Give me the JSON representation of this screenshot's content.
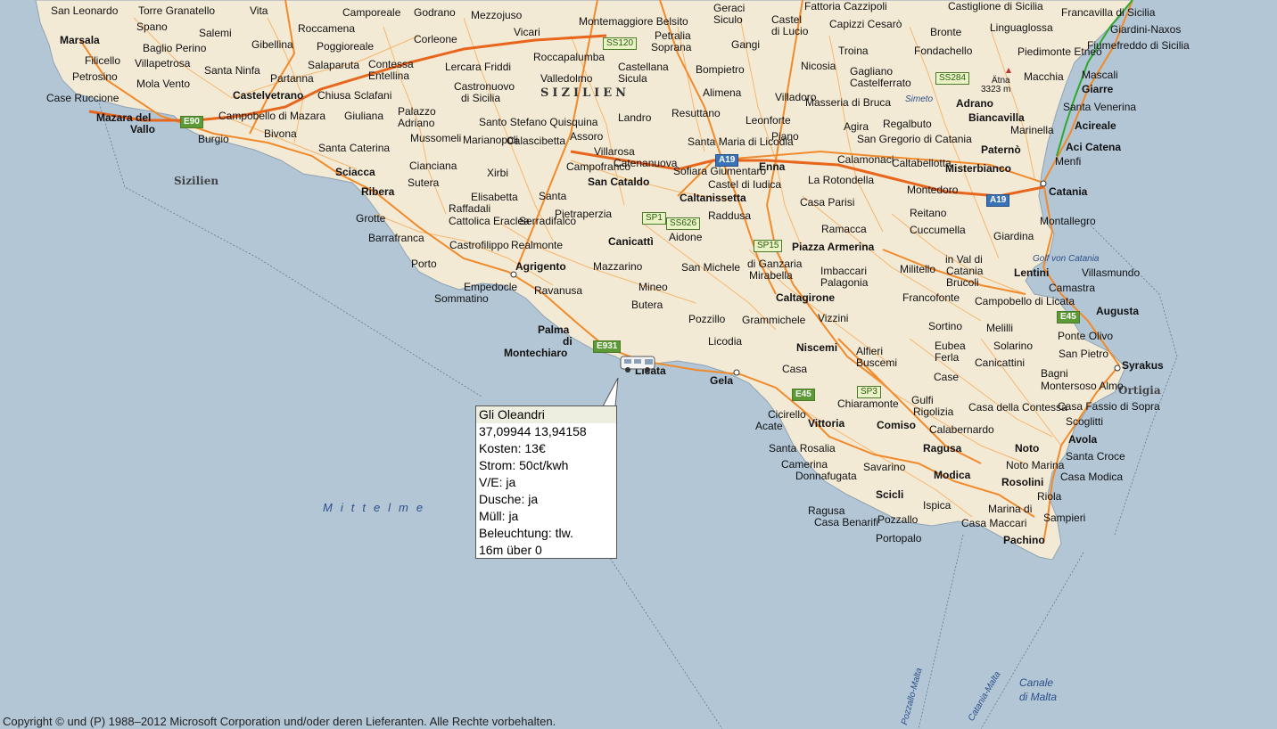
{
  "colors": {
    "sea": "#b3c6d6",
    "land": "#f3ead6",
    "major_road": "#f08a2a",
    "minor_road": "#f6b56c",
    "highway": "#e8651c",
    "water_label": "#2b4f88"
  },
  "cities_bold": [
    {
      "name": "Marsala",
      "id": "city-marsala"
    },
    {
      "name": "Mazara del",
      "id": "city-mazara-1"
    },
    {
      "name": "Vallo",
      "id": "city-mazara-2"
    },
    {
      "name": "Castelvetrano",
      "id": "city-castelvetrano"
    },
    {
      "name": "Sciacca",
      "id": "city-sciacca"
    },
    {
      "name": "Ribera",
      "id": "city-ribera"
    },
    {
      "name": "Agrigento",
      "id": "city-agrigento"
    },
    {
      "name": "San Cataldo",
      "id": "city-san-cataldo"
    },
    {
      "name": "Caltanissetta",
      "id": "city-caltanissetta"
    },
    {
      "name": "Canicattì",
      "id": "city-canicatti"
    },
    {
      "name": "Enna",
      "id": "city-enna"
    },
    {
      "name": "Piazza Armerina",
      "id": "city-piazza-armerina"
    },
    {
      "name": "Caltagirone",
      "id": "city-caltagirone"
    },
    {
      "name": "Niscemi",
      "id": "city-niscemi"
    },
    {
      "name": "Gela",
      "id": "city-gela"
    },
    {
      "name": "Vittoria",
      "id": "city-vittoria"
    },
    {
      "name": "Comiso",
      "id": "city-comiso"
    },
    {
      "name": "Ragusa",
      "id": "city-ragusa"
    },
    {
      "name": "Modica",
      "id": "city-modica"
    },
    {
      "name": "Scicli",
      "id": "city-scicli"
    },
    {
      "name": "Noto",
      "id": "city-noto"
    },
    {
      "name": "Avola",
      "id": "city-avola"
    },
    {
      "name": "Rosolini",
      "id": "city-rosolini"
    },
    {
      "name": "Pachino",
      "id": "city-pachino"
    },
    {
      "name": "Syrakus",
      "id": "city-syrakus"
    },
    {
      "name": "Augusta",
      "id": "city-augusta"
    },
    {
      "name": "Lentini",
      "id": "city-lentini"
    },
    {
      "name": "Catania",
      "id": "city-catania"
    },
    {
      "name": "Acireale",
      "id": "city-acireale"
    },
    {
      "name": "Aci Catena",
      "id": "city-aci-catena"
    },
    {
      "name": "Giarre",
      "id": "city-giarre"
    },
    {
      "name": "Adrano",
      "id": "city-adrano"
    },
    {
      "name": "Biancavilla",
      "id": "city-biancavilla"
    },
    {
      "name": "Paternò",
      "id": "city-paterno"
    },
    {
      "name": "Misterbianco",
      "id": "city-misterbianco"
    },
    {
      "name": "Palma",
      "id": "city-palma-1"
    },
    {
      "name": "di",
      "id": "city-palma-2"
    },
    {
      "name": "Montechiaro",
      "id": "city-palma-3"
    },
    {
      "name": "Licata",
      "id": "city-licata"
    }
  ],
  "towns": [
    "San Leonardo",
    "Torre Granatello",
    "Vita",
    "Camporeale",
    "Godrano",
    "Mezzojuso",
    "Montemaggiore Belsito",
    "Geraci",
    "Siculo",
    "Castel",
    "di Lucio",
    "Fattoria Cazzipoli",
    "Capizzi Cesarò",
    "Castiglione di Sicilia",
    "Francavilla di Sicilia",
    "Linguaglossa",
    "Giardini-Naxos",
    "Fiumefreddo di Sicilia",
    "Spano",
    "Salemi",
    "Gibellina",
    "Roccamena",
    "Corleone",
    "Vicari",
    "Petralia",
    "Soprana",
    "Gangi",
    "Troina",
    "Bronte",
    "Fondachello",
    "Piedimonte Etneo",
    "Baglio Perino",
    "Poggioreale",
    "Filicello",
    "Villapetrosa",
    "Santa Ninfa",
    "Salaparuta",
    "Contessa",
    "Entellina",
    "Lercara Friddi",
    "Roccapalumba",
    "Valledolmo",
    "Castellana",
    "Sicula",
    "Bompietro",
    "Nicosia",
    "Gagliano",
    "Castelferrato",
    "Mascali",
    "Petrosino",
    "Mola Vento",
    "Partanna",
    "Castronuovo",
    "di Sicilia",
    "Alimena",
    "Villadoro",
    "Masseria di Bruca",
    "Macchia",
    "Case Ruccione",
    "Chiusa Sclafani",
    "Resuttano",
    "Santa Venerina",
    "Campobello di Mazara",
    "Giuliana",
    "Palazzo",
    "Adriano",
    "Santo Stefano Quisquina",
    "Landro",
    "Leonforte",
    "Agira",
    "Regalbuto",
    "Marinella",
    "Menfi",
    "Burgio",
    "Bivona",
    "Mussomeli",
    "Marianopoli",
    "Calascibetta",
    "Assoro",
    "Santa Maria di Licodia",
    "Piano",
    "San Gregorio di Catania",
    "Caltabellotta",
    "Santa Caterina",
    "Villarosa",
    "Catenanuova",
    "Calamonaci",
    "Cianciana",
    "Sutera",
    "Campofranco",
    "Xirbi",
    "Sofiara Giumentaro",
    "Castel di Iudica",
    "La Rotondella",
    "Montedoro",
    "Santa",
    "Elisabetta",
    "Raffadali",
    "Cattolica Eraclea",
    "Grotte",
    "Serradifalco",
    "Pietraperzia",
    "Raddusa",
    "Casa Parisi",
    "Reitano",
    "Montallegro",
    "Barrafranca",
    "Aidone",
    "Ramacca",
    "Cuccumella",
    "Giardina",
    "Castrofilippo",
    "Realmonte",
    "Porto",
    "Empedocle",
    "Sommatino",
    "Mazzarino",
    "San Michele",
    "di Ganzaria",
    "Mirabella",
    "Imbaccari",
    "Palagonia",
    "Militello",
    "in Val di",
    "Catania",
    "Brucoli",
    "Villasmundo",
    "Camastra",
    "Ravanusa",
    "Mineo",
    "Francofonte",
    "Campobello di Licata",
    "Butera",
    "Pozzillo",
    "Grammichele",
    "Vizzini",
    "Sortino",
    "Melilli",
    "Ponte Olivo",
    "Licodia",
    "Eubea",
    "Ferla",
    "Solarino",
    "San Pietro",
    "Casa",
    "Alfieri",
    "Buscemi",
    "Canicattini",
    "Bagni",
    "Montersoso Almo",
    "Case",
    "Cicirello",
    "Acate",
    "Chiaramonte",
    "Gulfi",
    "Rigolizia",
    "Casa della Contessa",
    "Casa Fassio di Sopra",
    "Scoglitti",
    "Santa Rosalia",
    "Calabernardo",
    "Santa Croce",
    "Camerina",
    "Donnafugata",
    "Savarino",
    "Noto Marina",
    "Casa Modica",
    "Riola",
    "Ispica",
    "Marina di",
    "Ragusa",
    "Casa Benarifi",
    "Pozzallo",
    "Casa Maccari",
    "Sampieri",
    "Portopalo"
  ],
  "region_label": "SIZILIEN",
  "island_label": "Sizilien",
  "sea_label": "Mittelme",
  "gulf_label": "Golf von Catania",
  "canal_label_1": "Canale",
  "canal_label_2": "di Malta",
  "route_label_1": "Pozzallo-Malta",
  "route_label_2": "Catania-Malta",
  "river_label": "Simeto",
  "etna_label": "Ätna",
  "etna_height": "3323 m",
  "ortigia_label": "Ortigia",
  "shields": {
    "ss120": "SS120",
    "e90": "E90",
    "a19_1": "A19",
    "a19_2": "A19",
    "ss284": "SS284",
    "sp1": "SP1",
    "ss626": "SS626",
    "sp15": "SP15",
    "e931": "E931",
    "e45_1": "E45",
    "sp3": "SP3",
    "e45_2": "E45"
  },
  "popup": {
    "title": "Gli Oleandri",
    "lines": [
      "37,09944 13,94158",
      "Kosten: 13€",
      "Strom: 50ct/kwh",
      "V/E: ja",
      "Dusche: ja",
      "Müll: ja",
      "Beleuchtung: tlw.",
      "16m über 0"
    ]
  },
  "copyright": "Copyright © und (P) 1988–2012 Microsoft Corporation und/oder deren Lieferanten. Alle Rechte vorbehalten."
}
